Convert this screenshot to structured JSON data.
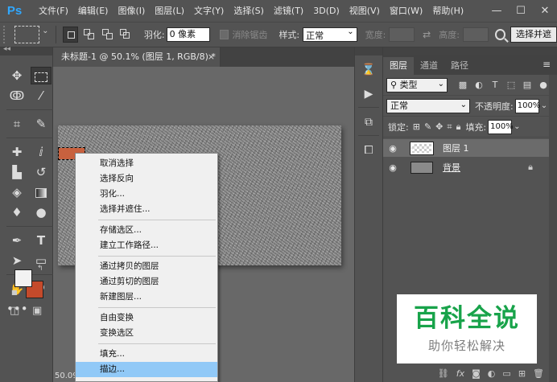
{
  "app": {
    "logo": "Ps",
    "menu": [
      "文件(F)",
      "编辑(E)",
      "图像(I)",
      "图层(L)",
      "文字(Y)",
      "选择(S)",
      "滤镜(T)",
      "3D(D)",
      "视图(V)",
      "窗口(W)",
      "帮助(H)"
    ],
    "window_controls": [
      "—",
      "☐",
      "✕"
    ]
  },
  "options": {
    "feather_label": "羽化:",
    "feather_value": "0 像素",
    "antialias_label": "消除锯齿",
    "style_label": "样式:",
    "style_value": "正常",
    "width_label": "宽度:",
    "height_label": "高度:",
    "select_mask_button": "选择并遮"
  },
  "toolbar": {
    "tools": [
      "move-icon",
      "marquee-icon",
      "lasso-icon",
      "magic-wand-icon",
      "crop-icon",
      "eyedropper-icon",
      "healing-icon",
      "brush-icon",
      "stamp-icon",
      "history-brush-icon",
      "eraser-icon",
      "gradient-icon",
      "blur-icon",
      "dodge-icon",
      "pen-icon",
      "type-icon",
      "path-select-icon",
      "rectangle-icon",
      "hand-icon",
      "zoom-icon"
    ],
    "more": "•••"
  },
  "document": {
    "tab_title": "未标题-1 @ 50.1% (图层 1, RGB/8) *",
    "tab_close": "×",
    "zoom_status": "50.09"
  },
  "context_menu": {
    "items": [
      "取消选择",
      "选择反向",
      "羽化...",
      "选择并遮住...",
      "存储选区...",
      "建立工作路径...",
      "通过拷贝的图层",
      "通过剪切的图层",
      "新建图层...",
      "自由变换",
      "变换选区",
      "填充...",
      "描边..."
    ],
    "highlighted": "描边..."
  },
  "layers_panel": {
    "tabs": [
      "图层",
      "通道",
      "路径"
    ],
    "filter_value": "类型",
    "blend_mode": "正常",
    "opacity_label": "不透明度:",
    "opacity_value": "100%",
    "lock_label": "锁定:",
    "fill_label": "填充:",
    "fill_value": "100%",
    "layers": [
      {
        "name": "图层 1",
        "selected": true
      },
      {
        "name": "背景",
        "selected": false
      }
    ]
  },
  "colors": {
    "foreground": "#f2f2f2",
    "background": "#c44a2b",
    "selection_fill": "#c8613e",
    "menu_highlight": "#91c9f7",
    "watermark_green": "#18a34a"
  },
  "watermark": {
    "title": "百科全说",
    "subtitle": "助你轻松解决"
  }
}
